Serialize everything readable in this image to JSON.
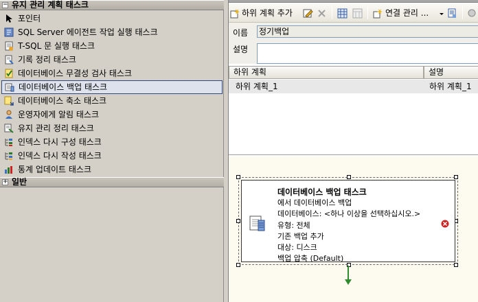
{
  "toolbox": {
    "section_title": "유지 관리 계획 태스크",
    "section_toggle": "−",
    "items": [
      {
        "label": "포인터",
        "icon": "pointer-icon"
      },
      {
        "label": "SQL Server 에이전트 작업 실행 태스크",
        "icon": "agent-job-icon"
      },
      {
        "label": "T-SQL 문 실행 태스크",
        "icon": "tsql-icon"
      },
      {
        "label": "기록 정리 태스크",
        "icon": "history-cleanup-icon"
      },
      {
        "label": "데이터베이스 무결성 검사 태스크",
        "icon": "integrity-check-icon"
      },
      {
        "label": "데이터베이스 백업 태스크",
        "icon": "backup-icon"
      },
      {
        "label": "데이터베이스 축소 태스크",
        "icon": "shrink-icon"
      },
      {
        "label": "운영자에게 알림 태스크",
        "icon": "notify-operator-icon"
      },
      {
        "label": "유지 관리 정리 태스크",
        "icon": "maintenance-cleanup-icon"
      },
      {
        "label": "인덱스 다시 구성 태스크",
        "icon": "reorganize-index-icon"
      },
      {
        "label": "인덱스 다시 작성 태스크",
        "icon": "rebuild-index-icon"
      },
      {
        "label": "통계 업데이트 태스크",
        "icon": "update-statistics-icon"
      }
    ],
    "selected_index": 5,
    "general_section": "일반",
    "general_toggle": "+"
  },
  "toolbar": {
    "add_subplan": "하위 계획 추가",
    "connection_mgr": "연결 관리 ..."
  },
  "properties": {
    "name_label": "이름",
    "name_value": "정기백업",
    "desc_label": "설명",
    "desc_value": ""
  },
  "subplan_grid": {
    "headers": [
      "하위 계획",
      "설명"
    ],
    "rows": [
      [
        "하위 계획_1",
        "하위 계획_1"
      ]
    ]
  },
  "task": {
    "title": "데이터베이스 백업 태스크",
    "line1": "에서 데이터베이스 백업",
    "line2": "데이터베이스: <하나 이상을 선택하십시오.>",
    "line3": "유형: 전체",
    "line4": "기존 백업 추가",
    "line5": "대상: 디스크",
    "line6": "백업 압축 (Default)"
  },
  "colors": {
    "selection_border": "#31477c",
    "error_red": "#cc2222",
    "connector_green": "#2e8b2e"
  }
}
